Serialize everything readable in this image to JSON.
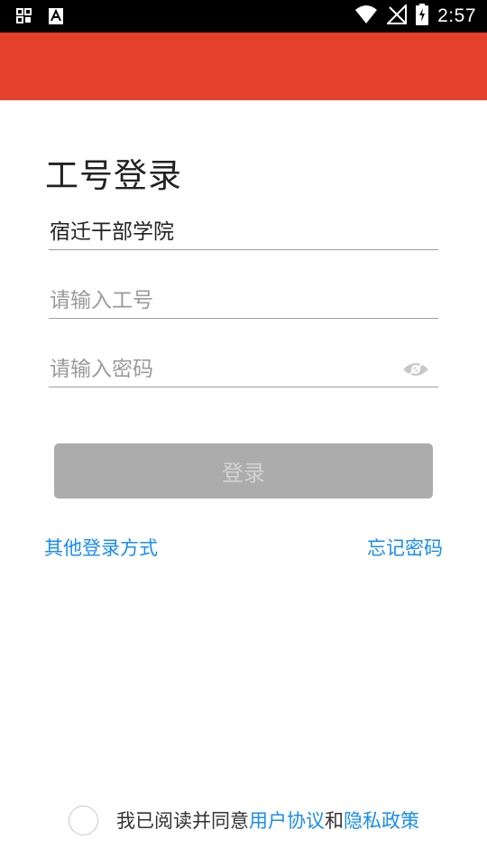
{
  "status_bar": {
    "time": "2:57",
    "left_icons": [
      "app-grid-icon",
      "font-a-icon"
    ],
    "right_icons": [
      "wifi-icon",
      "no-signal-icon",
      "battery-charging-icon"
    ]
  },
  "app_bar": {
    "color": "#e4402c"
  },
  "login": {
    "title": "工号登录",
    "school_value": "宿迁干部学院",
    "employee_id_placeholder": "请输入工号",
    "password_placeholder": "请输入密码",
    "password_toggle_icon": "eye-icon",
    "login_button": "登录",
    "other_login_link": "其他登录方式",
    "forgot_password_link": "忘记密码"
  },
  "agreement": {
    "prefix": "我已阅读并同意",
    "user_agreement": "用户协议",
    "conjunction": "和",
    "privacy_policy": "隐私政策"
  },
  "colors": {
    "accent": "#e4402c",
    "link": "#1a8cf0",
    "button_disabled": "#acacac"
  }
}
